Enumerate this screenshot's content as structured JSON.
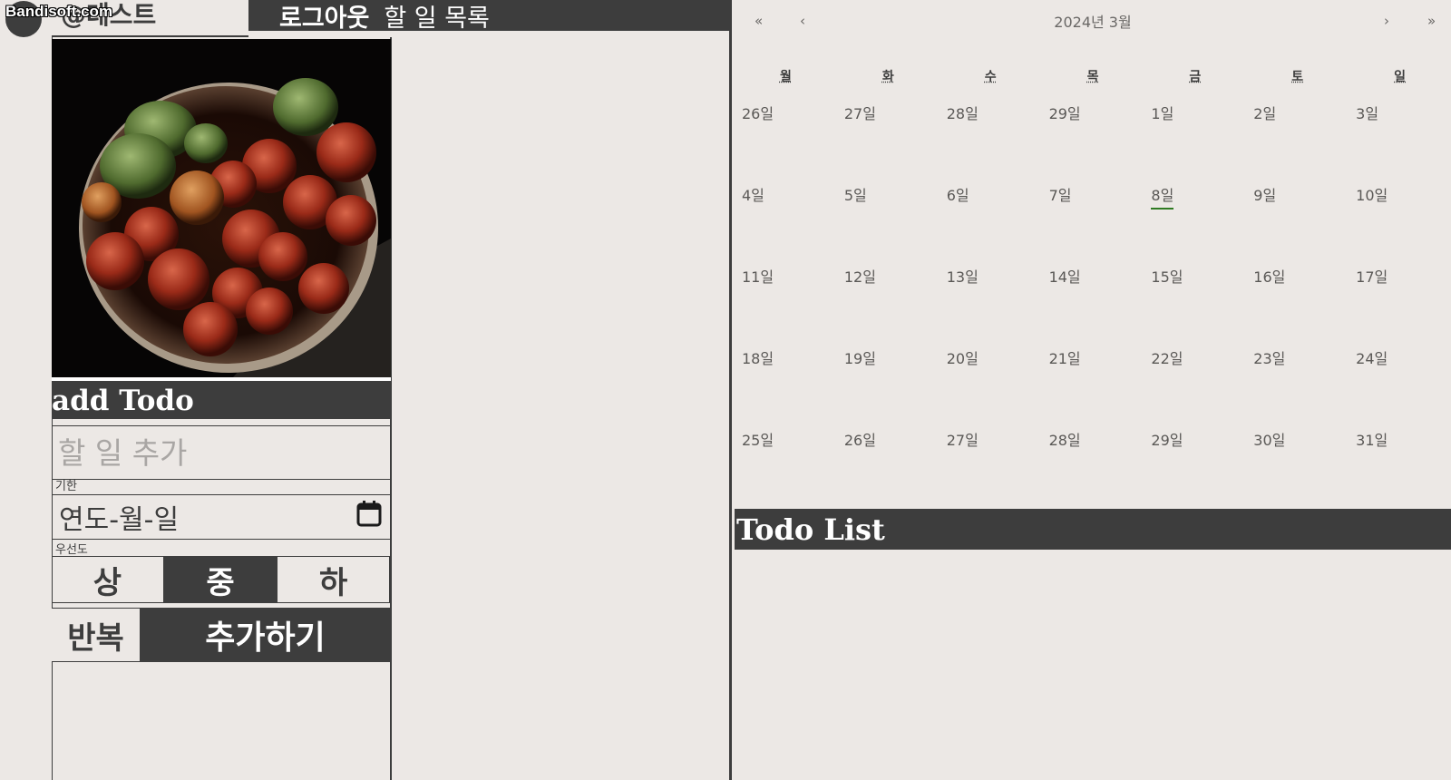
{
  "watermark": "Bandisoft.com",
  "brand": "@테스트",
  "header": {
    "logout": "로그아웃",
    "title": "할 일 목록"
  },
  "add_todo": {
    "title": "add Todo",
    "input_placeholder": "할 일 추가",
    "deadline_label": "기한",
    "date_placeholder": "연도-월-일",
    "priority_label": "우선도",
    "priorities": [
      {
        "label": "상",
        "active": false
      },
      {
        "label": "중",
        "active": true
      },
      {
        "label": "하",
        "active": false
      }
    ],
    "repeat_label": "반복",
    "submit_label": "추가하기"
  },
  "calendar": {
    "nav": {
      "prev_year": "«",
      "prev_month": "‹",
      "next_month": "›",
      "next_year": "»"
    },
    "title": "2024년 3월",
    "weekdays": [
      "월",
      "화",
      "수",
      "목",
      "금",
      "토",
      "일"
    ],
    "days": [
      "26일",
      "27일",
      "28일",
      "29일",
      "1일",
      "2일",
      "3일",
      "4일",
      "5일",
      "6일",
      "7일",
      "8일",
      "9일",
      "10일",
      "11일",
      "12일",
      "13일",
      "14일",
      "15일",
      "16일",
      "17일",
      "18일",
      "19일",
      "20일",
      "21일",
      "22일",
      "23일",
      "24일",
      "25일",
      "26일",
      "27일",
      "28일",
      "29일",
      "30일",
      "31일"
    ],
    "today_index": 11,
    "today_color": "#2f7a22"
  },
  "todo_list": {
    "title": "Todo List"
  },
  "colors": {
    "background": "#ece8e5",
    "dark": "#3d3d3d"
  }
}
